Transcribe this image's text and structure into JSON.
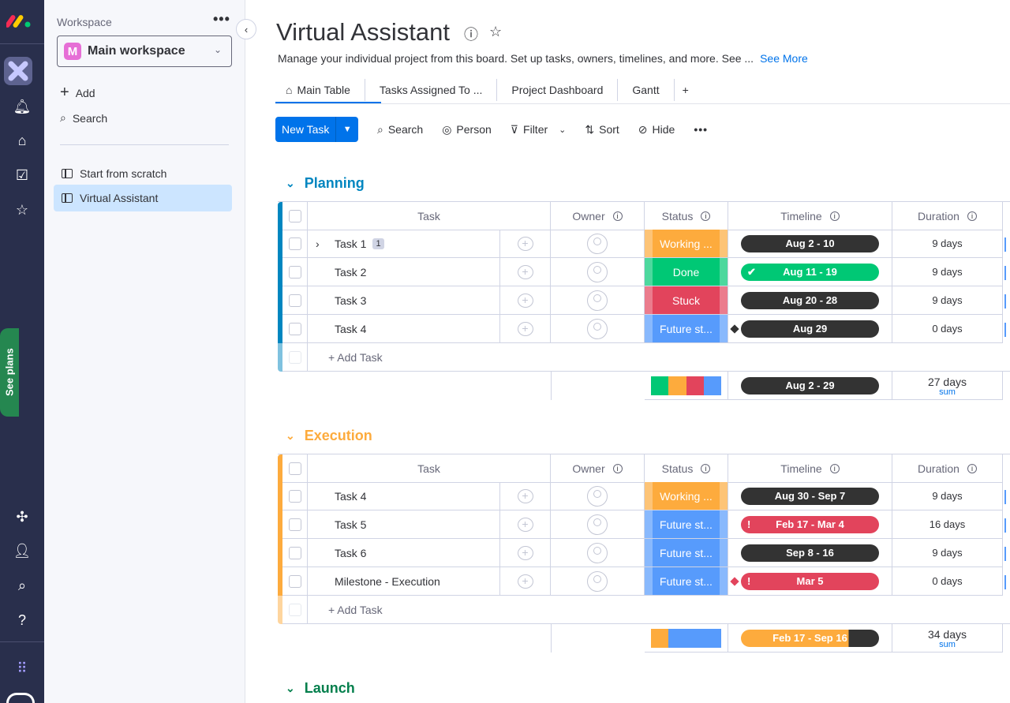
{
  "rail": {
    "see_plans": "See plans"
  },
  "sidebar": {
    "workspace_label": "Workspace",
    "workspace_name": "Main workspace",
    "workspace_initial": "M",
    "add": "Add",
    "search": "Search",
    "boards": [
      "Start from scratch",
      "Virtual Assistant"
    ]
  },
  "header": {
    "title": "Virtual Assistant",
    "description": "Manage your individual project from this board. Set up tasks, owners, timelines, and more. See ...",
    "see_more": "See More"
  },
  "tabs": [
    "Main Table",
    "Tasks Assigned To ...",
    "Project Dashboard",
    "Gantt",
    "+"
  ],
  "toolbar": {
    "new_task": "New Task",
    "search": "Search",
    "person": "Person",
    "filter": "Filter",
    "sort": "Sort",
    "hide": "Hide"
  },
  "columns": {
    "task": "Task",
    "owner": "Owner",
    "status": "Status",
    "timeline": "Timeline",
    "duration": "Duration"
  },
  "colors": {
    "working": "#fdab3d",
    "done": "#00c875",
    "stuck": "#e2445c",
    "future": "#579bfc",
    "dark": "#333333"
  },
  "groups": [
    {
      "name": "Planning",
      "color": "#0086c0",
      "rows": [
        {
          "task": "Task 1",
          "badge": "1",
          "expand": true,
          "status": "Working ...",
          "status_key": "working",
          "timeline": "Aug 2 - 10",
          "tl_color": "dark",
          "duration": "9 days"
        },
        {
          "task": "Task 2",
          "status": "Done",
          "status_key": "done",
          "timeline": "Aug 11 - 19",
          "tl_color": "done",
          "tl_mark": "✔",
          "duration": "9 days"
        },
        {
          "task": "Task 3",
          "status": "Stuck",
          "status_key": "stuck",
          "timeline": "Aug 20 - 28",
          "tl_color": "dark",
          "duration": "9 days"
        },
        {
          "task": "Task 4",
          "status": "Future st...",
          "status_key": "future",
          "timeline": "Aug 29",
          "tl_color": "dark",
          "milestone": "#333333",
          "duration": "0 days"
        }
      ],
      "add_task": "+ Add Task",
      "summary": {
        "status_mix": [
          [
            "done",
            1
          ],
          [
            "working",
            1
          ],
          [
            "stuck",
            1
          ],
          [
            "future",
            1
          ]
        ],
        "timeline": "Aug 2 - 29",
        "tl_progress": 0,
        "duration": "27 days",
        "duration_fn": "sum"
      }
    },
    {
      "name": "Execution",
      "color": "#fdab3d",
      "rows": [
        {
          "task": "Task 4",
          "status": "Working ...",
          "status_key": "working",
          "timeline": "Aug 30 - Sep 7",
          "tl_color": "dark",
          "duration": "9 days"
        },
        {
          "task": "Task 5",
          "status": "Future st...",
          "status_key": "future",
          "timeline": "Feb 17 - Mar 4",
          "tl_color": "stuck",
          "tl_mark": "!",
          "duration": "16 days"
        },
        {
          "task": "Task 6",
          "status": "Future st...",
          "status_key": "future",
          "timeline": "Sep 8 - 16",
          "tl_color": "dark",
          "duration": "9 days"
        },
        {
          "task": "Milestone - Execution",
          "status": "Future st...",
          "status_key": "future",
          "timeline": "Mar 5",
          "tl_color": "stuck",
          "tl_mark": "!",
          "milestone": "#e2445c",
          "duration": "0 days"
        }
      ],
      "add_task": "+ Add Task",
      "summary": {
        "status_mix": [
          [
            "working",
            1
          ],
          [
            "future",
            3
          ]
        ],
        "timeline": "Feb 17 - Sep 16",
        "tl_progress": 0.78,
        "duration": "34 days",
        "duration_fn": "sum"
      }
    },
    {
      "name": "Launch",
      "color": "#037f4c",
      "rows": []
    }
  ]
}
